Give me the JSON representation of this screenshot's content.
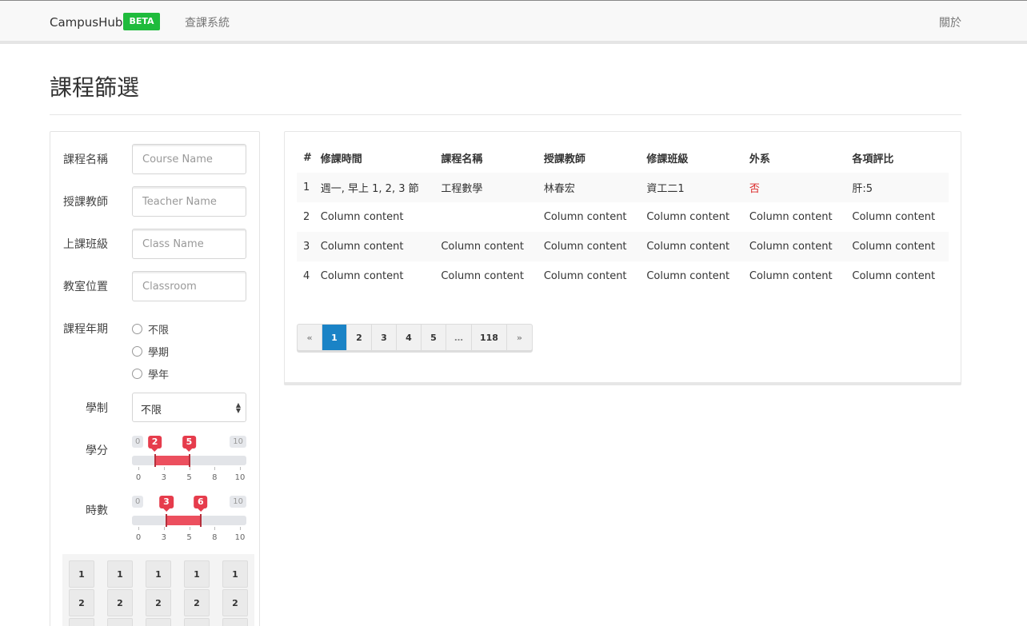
{
  "navbar": {
    "brand": "CampusHub",
    "badge": "BETA",
    "courses_link": "查課系統",
    "about_link": "關於"
  },
  "page": {
    "title": "課程篩選"
  },
  "filters": {
    "course_name": {
      "label": "課程名稱",
      "placeholder": "Course Name"
    },
    "teacher": {
      "label": "授課教師",
      "placeholder": "Teacher Name"
    },
    "class": {
      "label": "上課班級",
      "placeholder": "Class Name"
    },
    "classroom": {
      "label": "教室位置",
      "placeholder": "Classroom"
    },
    "term": {
      "label": "課程年期",
      "options": [
        "不限",
        "學期",
        "學年"
      ]
    },
    "system": {
      "label": "學制",
      "value": "不限"
    },
    "credits": {
      "label": "學分",
      "min": 0,
      "max": 10,
      "low": 2,
      "high": 5,
      "ticks": [
        "0",
        "3",
        "5",
        "8",
        "10"
      ]
    },
    "hours": {
      "label": "時數",
      "min": 0,
      "max": 10,
      "low": 3,
      "high": 6,
      "ticks": [
        "0",
        "3",
        "5",
        "8",
        "10"
      ]
    },
    "period_grid": {
      "rows": [
        "1",
        "2",
        ""
      ],
      "columns": 5
    }
  },
  "table": {
    "headers": [
      "#",
      "修課時間",
      "課程名稱",
      "授課教師",
      "修課班級",
      "外系",
      "各項評比"
    ],
    "rows": [
      [
        "1",
        "週一, 早上 1, 2, 3 節",
        "工程數學",
        "林春宏",
        "資工二1",
        "否",
        "肝:5"
      ],
      [
        "2",
        "Column content",
        "",
        "Column content",
        "Column content",
        "Column content",
        "Column content"
      ],
      [
        "3",
        "Column content",
        "Column content",
        "Column content",
        "Column content",
        "Column content",
        "Column content"
      ],
      [
        "4",
        "Column content",
        "Column content",
        "Column content",
        "Column content",
        "Column content",
        "Column content"
      ]
    ]
  },
  "pagination": [
    "«",
    "1",
    "2",
    "3",
    "4",
    "5",
    "…",
    "118",
    "»"
  ],
  "pagination_active": "1",
  "colors": {
    "accent": "#1a83c6",
    "badge": "#1fbb3c",
    "slider": "#ec4f5e",
    "negative": "#db2828"
  }
}
